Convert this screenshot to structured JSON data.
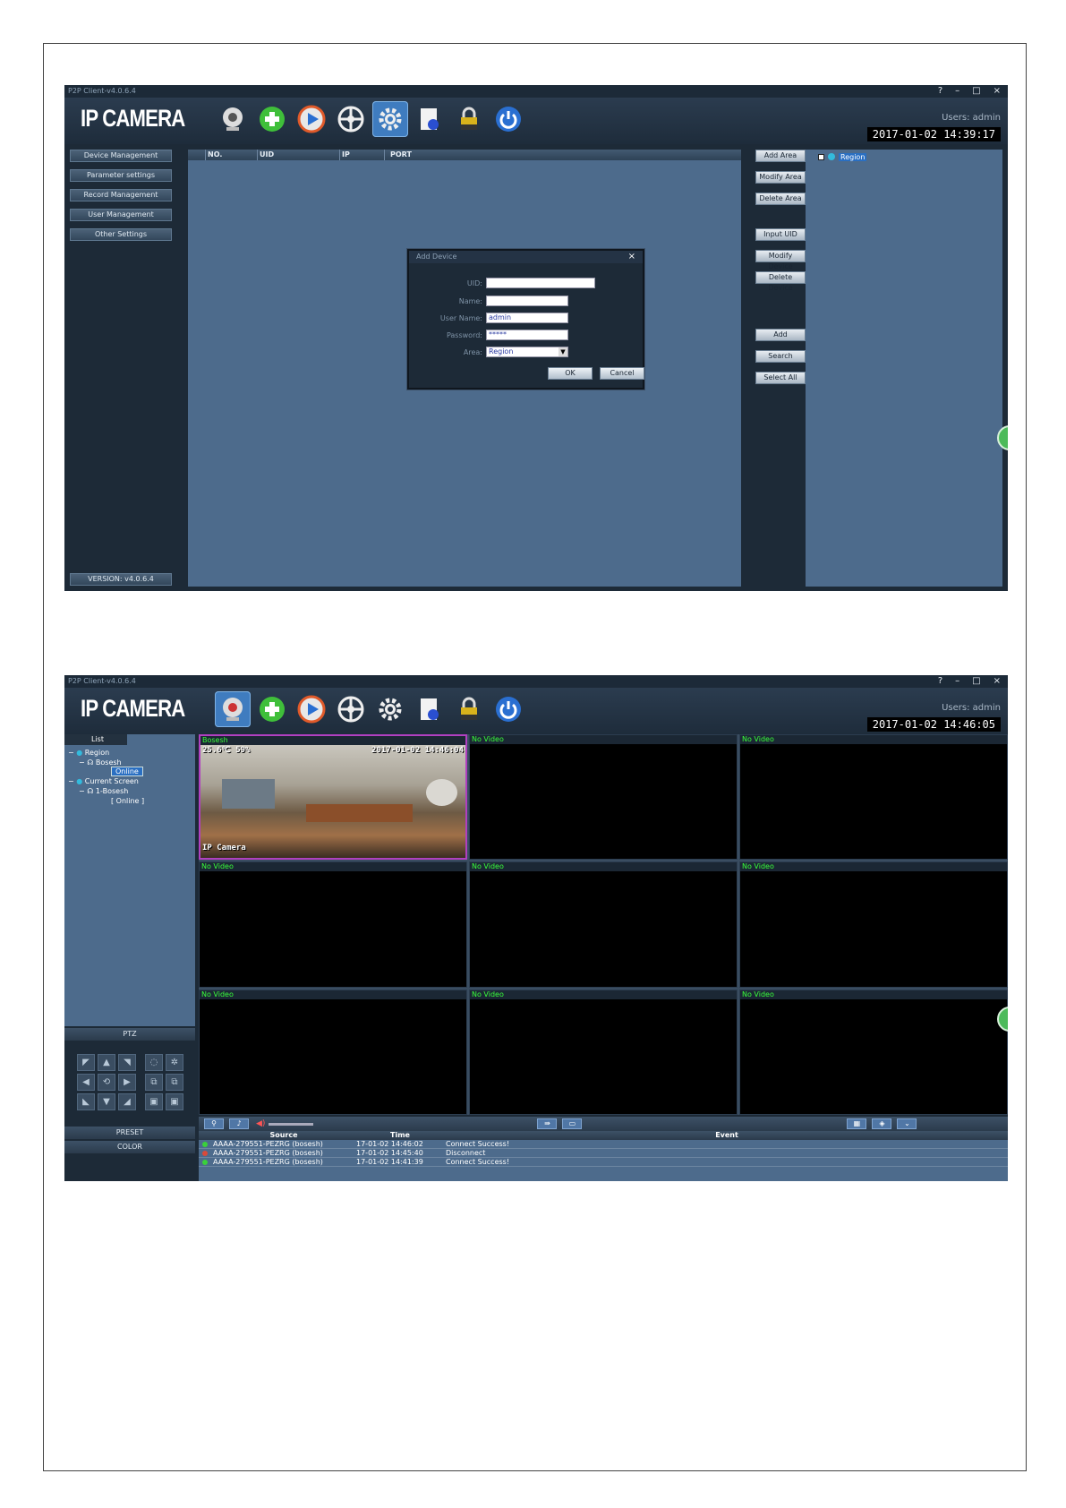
{
  "app": {
    "title": "P2P Client-v4.0.6.4",
    "logo": "IP CAMERA",
    "users": "Users: admin",
    "window_controls": [
      "?",
      "–",
      "□",
      "×"
    ]
  },
  "screen1": {
    "clock": "2017-01-02 14:39:17",
    "left_nav": [
      "Device Management",
      "Parameter settings",
      "Record Management",
      "User Management",
      "Other Settings"
    ],
    "version": "VERSION: v4.0.6.4",
    "table_headers": [
      "NO.",
      "UID",
      "IP",
      "PORT"
    ],
    "side_buttons": [
      "Add Area",
      "Modify Area",
      "Delete Area",
      "Input UID",
      "Modify Device",
      "Delete Device",
      "Add",
      "Search",
      "Select All"
    ],
    "region_label": "Region",
    "dialog": {
      "title": "Add Device",
      "close": "×",
      "fields": {
        "uid_label": "UID:",
        "uid_value": "",
        "name_label": "Name:",
        "name_value": "",
        "username_label": "User Name:",
        "username_value": "admin",
        "password_label": "Password:",
        "password_value": "*****",
        "area_label": "Area:",
        "area_value": "Region"
      },
      "ok": "OK",
      "cancel": "Cancel"
    }
  },
  "screen2": {
    "clock": "2017-01-02 14:46:05",
    "tree": {
      "tab": "List",
      "region": "Region",
      "device": "Bosesh",
      "device_status": "Online",
      "current_screen": "Current Screen",
      "screen_device": "1-Bosesh",
      "screen_status": "[   Online   ]"
    },
    "ptz_label": "PTZ",
    "preset_label": "PRESET",
    "color_label": "COLOR",
    "cells": [
      "Bosesh",
      "No Video",
      "No Video",
      "No Video",
      "No Video",
      "No Video",
      "No Video",
      "No Video",
      "No Video"
    ],
    "osd": {
      "top": "25.6℃  59%",
      "timestamp": "2017-01-02 14:46:04",
      "bottom": "IP Camera"
    },
    "log_headers": [
      "Source",
      "Time",
      "Event"
    ],
    "log_rows": [
      {
        "source": "AAAA-279551-PEZRG (bosesh)",
        "time": "17-01-02 14:46:02",
        "event": "Connect Success!",
        "status_color": "#3ad13a"
      },
      {
        "source": "AAAA-279551-PEZRG (bosesh)",
        "time": "17-01-02 14:45:40",
        "event": "Disconnect",
        "status_color": "#d94a3a"
      },
      {
        "source": "AAAA-279551-PEZRG (bosesh)",
        "time": "17-01-02 14:41:39",
        "event": "Connect Success!",
        "status_color": "#3ad13a"
      }
    ]
  },
  "colors": {
    "accent": "#3f7cbf",
    "panel": "#4d6b8c",
    "no_video_text": "#39ff3a"
  }
}
